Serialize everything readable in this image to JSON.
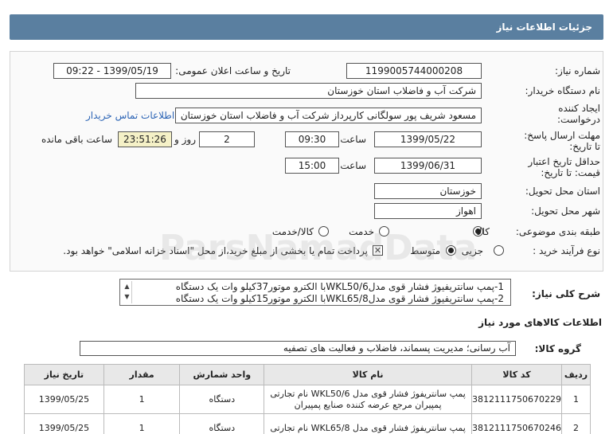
{
  "header": {
    "title": "جزئیات اطلاعات نیاز"
  },
  "form": {
    "need_number_label": "شماره نیاز:",
    "need_number": "1199005744000208",
    "announce_label": "تاریخ و ساعت اعلان عمومی:",
    "announce_value": "1399/05/19 - 09:22",
    "buyer_label": "نام دستگاه خریدار:",
    "buyer": "شرکت آب و فاضلاب استان خوزستان",
    "creator_label_1": "ایجاد کننده",
    "creator_label_2": "درخواست:",
    "creator": "مسعود شریف پور سولگانی کارپرداز شرکت آب و فاضلاب استان خوزستان",
    "contact_link": "اطلاعات تماس خریدار",
    "send_deadline_label_1": "مهلت ارسال پاسخ:",
    "send_deadline_label_2": "تا تاریخ:",
    "send_date": "1399/05/22",
    "time_label": "ساعت",
    "send_time": "09:30",
    "days": "2",
    "days_label": "روز و",
    "remaining_time": "23:51:26",
    "remaining_label": "ساعت باقی مانده",
    "validity_label_1": "حداقل تاریخ اعتبار",
    "validity_label_2": "قیمت: تا تاریخ:",
    "validity_date": "1399/06/31",
    "validity_time_label": "ساعت",
    "validity_time": "15:00",
    "province_label": "استان محل تحویل:",
    "province": "خوزستان",
    "city_label": "شهر محل تحویل:",
    "city": "اهواز",
    "category_label": "طبقه بندی موضوعی:",
    "category_options": [
      "کالا",
      "خدمت",
      "کالا/خدمت"
    ],
    "category_selected": 0,
    "process_label": "نوع فرآیند خرید :",
    "process_options": [
      "جزیی",
      "متوسط"
    ],
    "process_selected": 1,
    "payment_note": "پرداخت تمام یا بخشی از مبلغ خرید،از محل \"اسناد خزانه اسلامی\" خواهد بود."
  },
  "description": {
    "label": "شرح کلی نیاز:",
    "line1": "1-پمپ سانتریفیوژ فشار قوی مدلWKL50/6با الکترو موتور37کیلو وات یک دستگاه",
    "line2": "2-پمپ سانتریفیوژ فشار قوی مدلWKL65/8با الکترو موتور15کیلو وات یک دستگاه"
  },
  "goods_section": {
    "title": "اطلاعات کالاهای مورد نیاز",
    "group_label": "گروه کالا:",
    "group_value": "آب رسانی؛ مدیریت پسماند، فاضلاب و فعالیت های تصفیه"
  },
  "table": {
    "headers": [
      "ردیف",
      "کد کالا",
      "نام کالا",
      "واحد شمارش",
      "مقدار",
      "تاریخ نیاز"
    ],
    "rows": [
      {
        "row": "1",
        "code": "3812111750670229",
        "name_line1": "پمپ سانتریفوژ فشار قوی مدل WKL50/6 نام تجارتی",
        "name_line2": "پمپیران مرجع عرضه کننده صنایع پمپیران",
        "unit": "دستگاه",
        "qty": "1",
        "date": "1399/05/25"
      },
      {
        "row": "2",
        "code": "3812111750670246",
        "name_line1": "پمپ سانتریفوژ فشار قوی مدل WKL65/8 نام تجارتی",
        "name_line2": "",
        "unit": "دستگاه",
        "qty": "1",
        "date": "1399/05/25"
      }
    ]
  },
  "watermark": {
    "text": "ParsNamadData"
  },
  "colors": {
    "header_bg": "#5a7fa0",
    "link": "#2c64b5",
    "time_bg": "#f5f1c7"
  }
}
